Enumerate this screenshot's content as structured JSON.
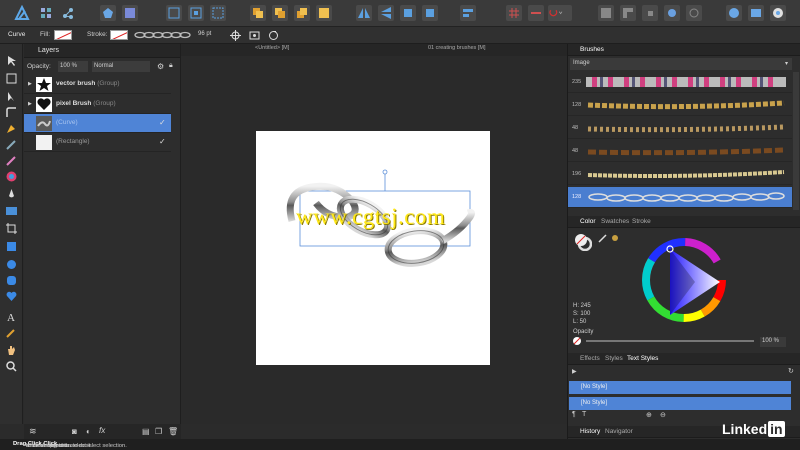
{
  "context_toolbar": {
    "tool_name": "Curve",
    "fill_label": "Fill:",
    "stroke_label": "Stroke:",
    "stroke_width": "96 pt"
  },
  "layers_panel": {
    "title": "Layers",
    "opacity_label": "Opacity:",
    "opacity_value": "100 %",
    "blend_mode": "Normal",
    "layers": [
      {
        "name": "vector brush",
        "type": "(Group)",
        "checked": ""
      },
      {
        "name": "pixel Brush",
        "type": "(Group)",
        "checked": ""
      },
      {
        "name": "(Curve)",
        "type": "",
        "checked": "✓"
      },
      {
        "name": "(Rectangle)",
        "type": "",
        "checked": "✓"
      }
    ]
  },
  "document_tabs": [
    {
      "label": "<Untitled> [M]"
    },
    {
      "label": "01 creating brushes [M]"
    }
  ],
  "brushes_panel": {
    "title": "Brushes",
    "category": "Image",
    "sizes": [
      "235",
      "128",
      "48",
      "48",
      "196",
      "128"
    ]
  },
  "color_panel": {
    "tabs": [
      "Color",
      "Swatches",
      "Stroke"
    ],
    "h": "H: 245",
    "s": "S: 100",
    "l": "L: 50",
    "opacity_label": "Opacity",
    "opacity_value": "100 %"
  },
  "styles_panel": {
    "tabs": [
      "Effects",
      "Styles",
      "Text Styles"
    ],
    "rows": [
      "[No Style]",
      "[No Style]"
    ]
  },
  "history_panel": {
    "tabs": [
      "History",
      "Navigator"
    ]
  },
  "status": {
    "selected": "'Curve' selected.",
    "drag_word": "Drag",
    "drag_text": "to move selection.",
    "click_word": "Click",
    "click_text": "another object to select it.",
    "click2_word": "Click",
    "click2_text": "on an empty area to deselect selection."
  },
  "watermark": "www.cgtsj.com",
  "brand": {
    "linked": "Linked",
    "in": "in"
  },
  "colors": {
    "accent_blue": "#4f84d6",
    "toolbar_bg": "#3a3a3a",
    "panel_bg": "#2d2d2d",
    "watermark_yellow": "#ffe81a"
  }
}
